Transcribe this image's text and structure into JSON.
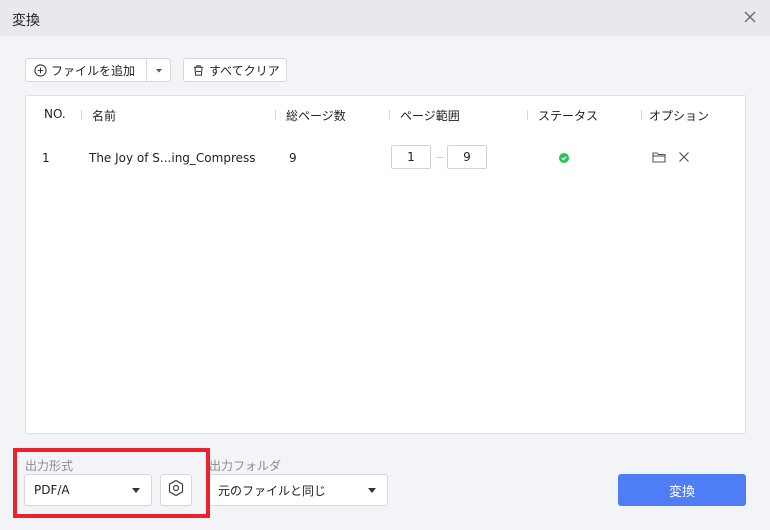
{
  "window": {
    "title": "変換"
  },
  "toolbar": {
    "add_file_label": "ファイルを追加",
    "clear_all_label": "すべてクリア"
  },
  "table": {
    "headers": {
      "no": "NO.",
      "name": "名前",
      "total_pages": "総ページ数",
      "page_range": "ページ範囲",
      "status": "ステータス",
      "options": "オプション"
    },
    "rows": [
      {
        "no": "1",
        "name": "The Joy of S...ing_Compress",
        "total_pages": "9",
        "range_from": "1",
        "range_to": "9",
        "status": "success"
      }
    ]
  },
  "output_format": {
    "label": "出力形式",
    "value": "PDF/A"
  },
  "output_folder": {
    "label": "出力フォルダ",
    "value": "元のファイルと同じ"
  },
  "actions": {
    "convert_label": "変換"
  },
  "colors": {
    "accent": "#4f7df5",
    "status_ok": "#22c55e",
    "highlight": "#e8232c"
  }
}
